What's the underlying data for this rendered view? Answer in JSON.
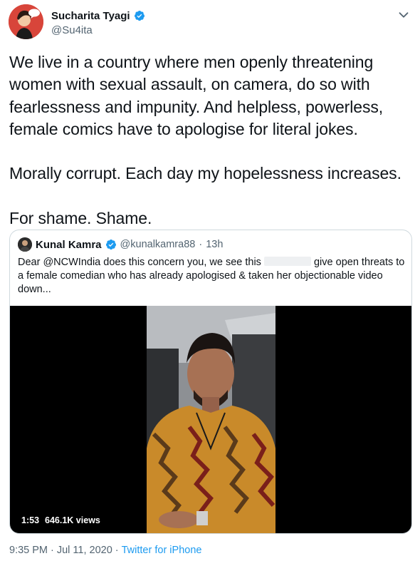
{
  "tweet": {
    "author": {
      "display_name": "Sucharita Tyagi",
      "handle": "@Su4ita",
      "verified": true
    },
    "text": "We live in a country where men openly threatening women with sexual assault, on camera, do so with fearlessness and impunity. And helpless, powerless, female comics have to apologise for literal jokes.\n\nMorally corrupt. Each day my hopelessness increases.\n\nFor shame. Shame.",
    "time": "9:35 PM",
    "date": "Jul 11, 2020",
    "separator": "·",
    "source": "Twitter for iPhone"
  },
  "quote": {
    "author": {
      "display_name": "Kunal Kamra",
      "handle": "@kunalkamra88",
      "verified": true
    },
    "dot": "·",
    "time": "13h",
    "text_before": "Dear @NCWIndia does this concern you, we see this ",
    "text_after": " give open threats to a female comedian who has already apologised & taken her objectionable video down...",
    "video": {
      "duration": "1:53",
      "views": "646.1K views"
    }
  },
  "colors": {
    "verified": "#1d9bf0",
    "muted": "#536471",
    "link": "#1d9bf0",
    "border": "#cfd9de"
  },
  "icons": {
    "more": "chevron-down-icon",
    "verified": "verified-badge-icon"
  }
}
